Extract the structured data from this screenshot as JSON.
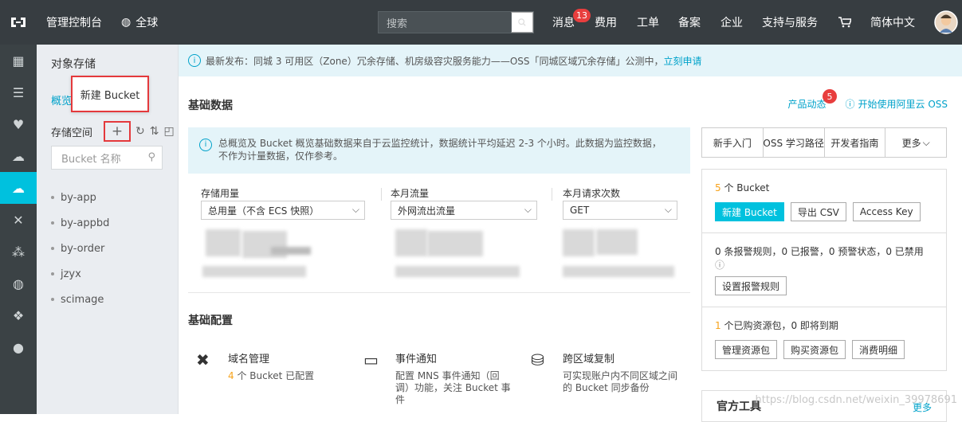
{
  "topbar": {
    "console": "管理控制台",
    "region": "全球",
    "search_placeholder": "搜索",
    "nav": [
      "消息",
      "费用",
      "工单",
      "备案",
      "企业",
      "支持与服务",
      "简体中文"
    ],
    "msg_count": "13"
  },
  "sidebar": {
    "title": "对象存储",
    "overview_tab": "概览",
    "storage_label": "存储空间",
    "bucket_search_placeholder": "Bucket 名称",
    "buckets": [
      "by-app",
      "by-appbd",
      "by-order",
      "jzyx",
      "scimage"
    ]
  },
  "popup": {
    "label": "新建 Bucket"
  },
  "notice": {
    "text": "最新发布：同城 3 可用区（Zone）冗余存储、机房级容灾服务能力——OSS「同城区域冗余存储」公测中，",
    "link": "立刻申请"
  },
  "main": {
    "basic_data": "基础数据",
    "product_news": "产品动态",
    "product_news_count": "5",
    "start_link": "开始使用阿里云 OSS",
    "info_line1": "总概览及 Bucket 概览基础数据来自于云监控统计，数据统计平均延迟 2-3 个小时。此数据为监控数据，",
    "info_line2": "不作为计量数据，仅作参考。",
    "metrics": [
      {
        "label": "存储用量",
        "select": "总用量（不含 ECS 快照）"
      },
      {
        "label": "本月流量",
        "select": "外网流出流量"
      },
      {
        "label": "本月请求次数",
        "select": "GET"
      }
    ],
    "basic_config": "基础配置",
    "configs": [
      {
        "title": "域名管理",
        "count": "4",
        "desc": "个 Bucket 已配置"
      },
      {
        "title": "事件通知",
        "desc": "配置 MNS 事件通知（回调）功能，关注 Bucket 事件"
      },
      {
        "title": "跨区域复制",
        "desc": "可实现账户内不同区域之间的 Bucket 同步备份"
      }
    ]
  },
  "rpanel": {
    "tabs": [
      "新手入门",
      "OSS 学习路径",
      "开发者指南",
      "更多"
    ],
    "bucket_count": "5",
    "bucket_text": "个 Bucket",
    "buttons1": [
      "新建 Bucket",
      "导出 CSV",
      "Access Key"
    ],
    "alarm_text": "0 条报警规则，0 已报警，0 预警状态，0 已禁用",
    "alarm_button": "设置报警规则",
    "pkg_count": "1",
    "pkg_text": "个已购资源包，0 即将到期",
    "buttons2": [
      "管理资源包",
      "购买资源包",
      "消费明细"
    ],
    "official": "官方工具",
    "more": "更多"
  },
  "watermark": "https://blog.csdn.net/weixin_39978691"
}
